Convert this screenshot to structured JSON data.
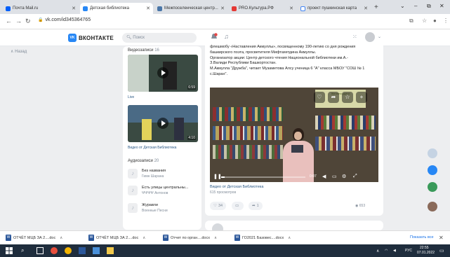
{
  "browser": {
    "tabs": [
      {
        "title": "Почта Mail.ru",
        "color": "#005ff9"
      },
      {
        "title": "Детская библиотека",
        "color": "#2787f5"
      },
      {
        "title": "Межпоселенческая центр...",
        "color": "#4a76a8"
      },
      {
        "title": "PRO.Культура.РФ",
        "color": "#e53935"
      },
      {
        "title": "проект пушкинская карта",
        "color": "#ffffff"
      }
    ],
    "new_tab": "+",
    "url": "vk.com/id345364765",
    "window_controls": [
      "⌄",
      "–",
      "⧉",
      "✕"
    ]
  },
  "vk": {
    "logo_mark": "VK",
    "logo_text": "ВКОНТАКТЕ",
    "search_placeholder": "Поиск",
    "nav_back": "Назад"
  },
  "left_panel": {
    "videos_title": "Видеозаписи",
    "videos_count": "16",
    "video1_duration": "6:59",
    "video1_label": "Live",
    "video2_duration": "4:10",
    "video2_label": "Видео от Детская Библиотека",
    "audio_title": "Аудиозаписи",
    "audio_count": "20",
    "tracks": [
      {
        "title": "Без названия",
        "artist": "Гимн Шарана"
      },
      {
        "title": "Есть улицы центральны...",
        "artist": "ΨΨΨΨ Антонов"
      },
      {
        "title": "Журавли",
        "artist": "Военные Песни"
      }
    ]
  },
  "post": {
    "text_lines": [
      "флешмобу «Наставления Акмуллы», посвященному 190-летию со дня рождения",
      "башкирского поэта, просветителя Мифтахетдина Акмуллы.",
      "Организатор акции: Центр детского чтения Национальной библиотеки им.А.-",
      "З.Валиди Республики Башкортостан.",
      "М.Акмулла \"Дружба\", читает Музаметова Алсу ученица 6 \"А\" класса МБОУ \"СОШ № 1",
      "с.Шаран\"."
    ],
    "banner_text": "Желаем удачи",
    "video_time": "0:07",
    "video_progress": 0.04,
    "video_title": "Видео от Детская Библиотека",
    "video_views": "615 просмотров",
    "likes": "34",
    "comments": "",
    "shares": "1",
    "views": "653"
  },
  "downloads": {
    "items": [
      "ОТЧЁТ МЦБ ЗА 2....doc",
      "ОТЧЁТ МЦБ ЗА 2....doc",
      "Отчет по орган....docx",
      "ГО2021 Базовес....docx"
    ],
    "show_all": "Показать все"
  },
  "taskbar": {
    "lang": "РУС",
    "time": "22:55",
    "date": "07.01.2022"
  }
}
